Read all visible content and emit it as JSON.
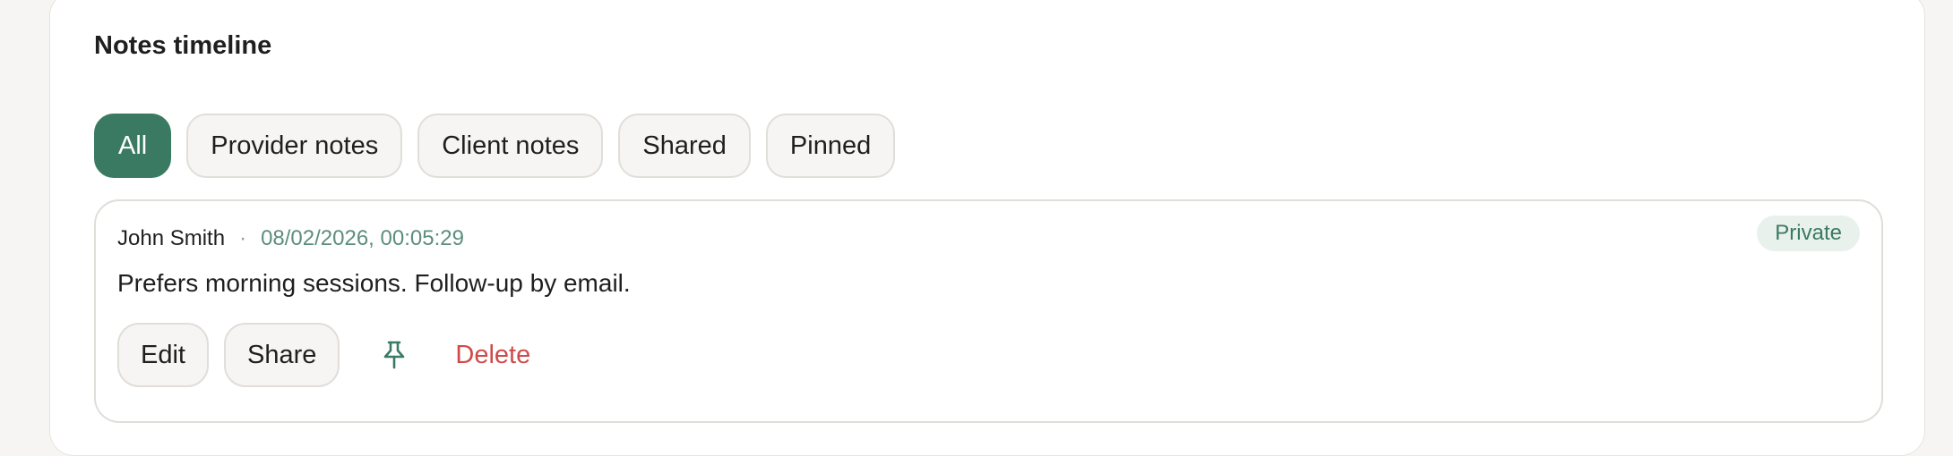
{
  "section": {
    "title": "Notes timeline"
  },
  "filters": [
    {
      "label": "All",
      "active": true
    },
    {
      "label": "Provider notes",
      "active": false
    },
    {
      "label": "Client notes",
      "active": false
    },
    {
      "label": "Shared",
      "active": false
    },
    {
      "label": "Pinned",
      "active": false
    }
  ],
  "note": {
    "author": "John Smith",
    "separator": "·",
    "timestamp": "08/02/2026, 00:05:29",
    "visibility": "Private",
    "body": "Prefers morning sessions. Follow-up by email.",
    "actions": {
      "edit_label": "Edit",
      "share_label": "Share",
      "pin_icon": "pin-icon",
      "delete_label": "Delete"
    }
  },
  "colors": {
    "accent": "#3a7a63",
    "danger": "#d04a4a",
    "timestamp": "#5c8e7d",
    "badge_bg": "#e9f1ed"
  }
}
